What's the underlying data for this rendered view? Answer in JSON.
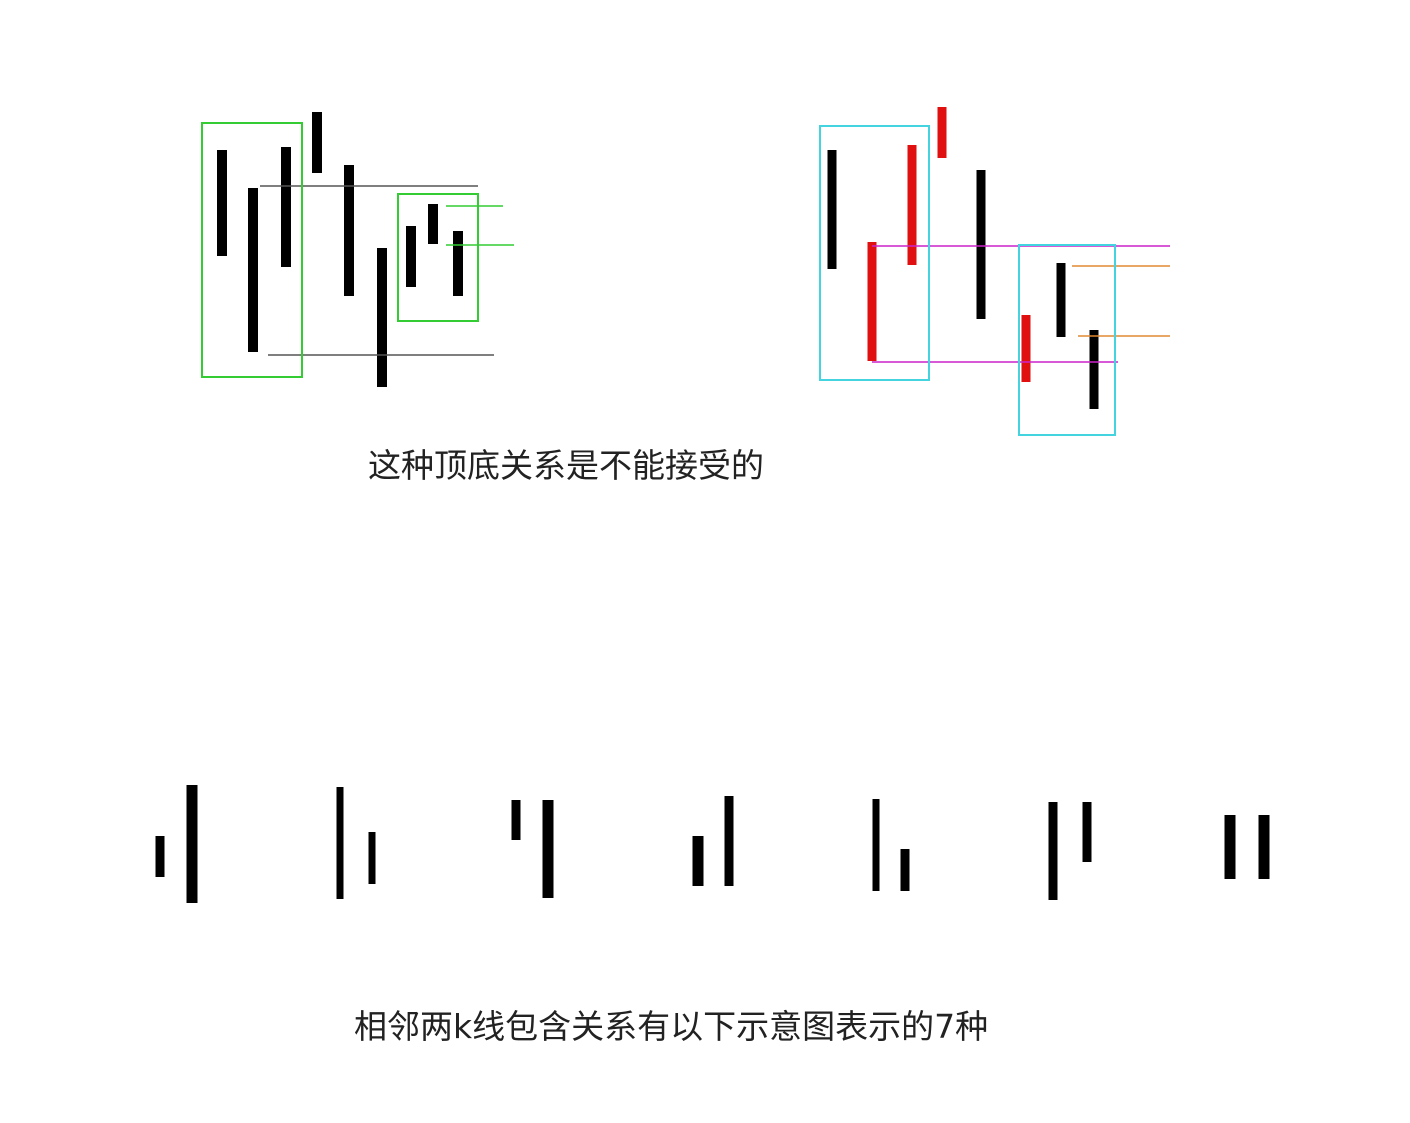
{
  "captions": {
    "top": "这种顶底关系是不能接受的",
    "bottom": "相邻两k线包含关系有以下示意图表示的7种"
  },
  "colors": {
    "bar": "#000000",
    "bar_highlight": "#e01010",
    "box_left": "#33cc33",
    "box_right": "#44d4e0",
    "line_gray": "#555555",
    "line_green": "#33cc33",
    "line_magenta": "#cc22cc",
    "line_orange": "#e08a30"
  },
  "diagram": {
    "left_panel": {
      "bars": [
        {
          "color": "bar"
        },
        {
          "color": "bar"
        },
        {
          "color": "bar"
        },
        {
          "color": "bar"
        },
        {
          "color": "bar"
        },
        {
          "color": "bar"
        },
        {
          "color": "bar"
        },
        {
          "color": "bar"
        },
        {
          "color": "bar"
        }
      ]
    },
    "right_panel": {
      "bars": [
        {
          "color": "bar"
        },
        {
          "color": "bar_highlight"
        },
        {
          "color": "bar_highlight"
        },
        {
          "color": "bar_highlight"
        },
        {
          "color": "bar"
        },
        {
          "color": "bar_highlight"
        },
        {
          "color": "bar"
        },
        {
          "color": "bar"
        }
      ]
    },
    "inclusion_cases": {
      "count": 7
    }
  }
}
